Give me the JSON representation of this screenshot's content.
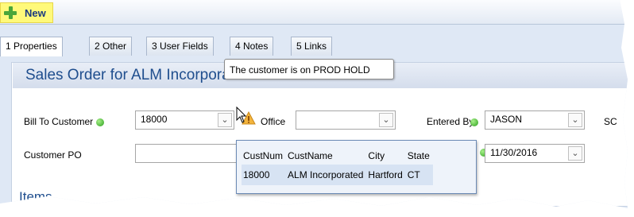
{
  "toolbar": {
    "new_label": "New"
  },
  "tabs": [
    {
      "label": "1 Properties"
    },
    {
      "label": "2 Other"
    },
    {
      "label": "3 User Fields"
    },
    {
      "label": "4 Notes"
    },
    {
      "label": "5 Links"
    }
  ],
  "section_title": "Sales Order for ALM Incorporated",
  "tooltip": "The customer is on PROD HOLD",
  "fields": {
    "bill_to_label": "Bill To Customer",
    "bill_to_value": "18000",
    "office_label": "Office",
    "office_value": "",
    "entered_by_label": "Entered By",
    "entered_by_value": "JASON",
    "cutoff_label": "SC",
    "customer_po_label": "Customer PO",
    "customer_po_value": "",
    "date_value": "11/30/2016"
  },
  "lookup": {
    "headers": [
      "CustNum",
      "CustName",
      "City",
      "State"
    ],
    "rows": [
      [
        "18000",
        "ALM Incorporated",
        "Hartford",
        "CT"
      ]
    ]
  },
  "items_heading": "Items"
}
